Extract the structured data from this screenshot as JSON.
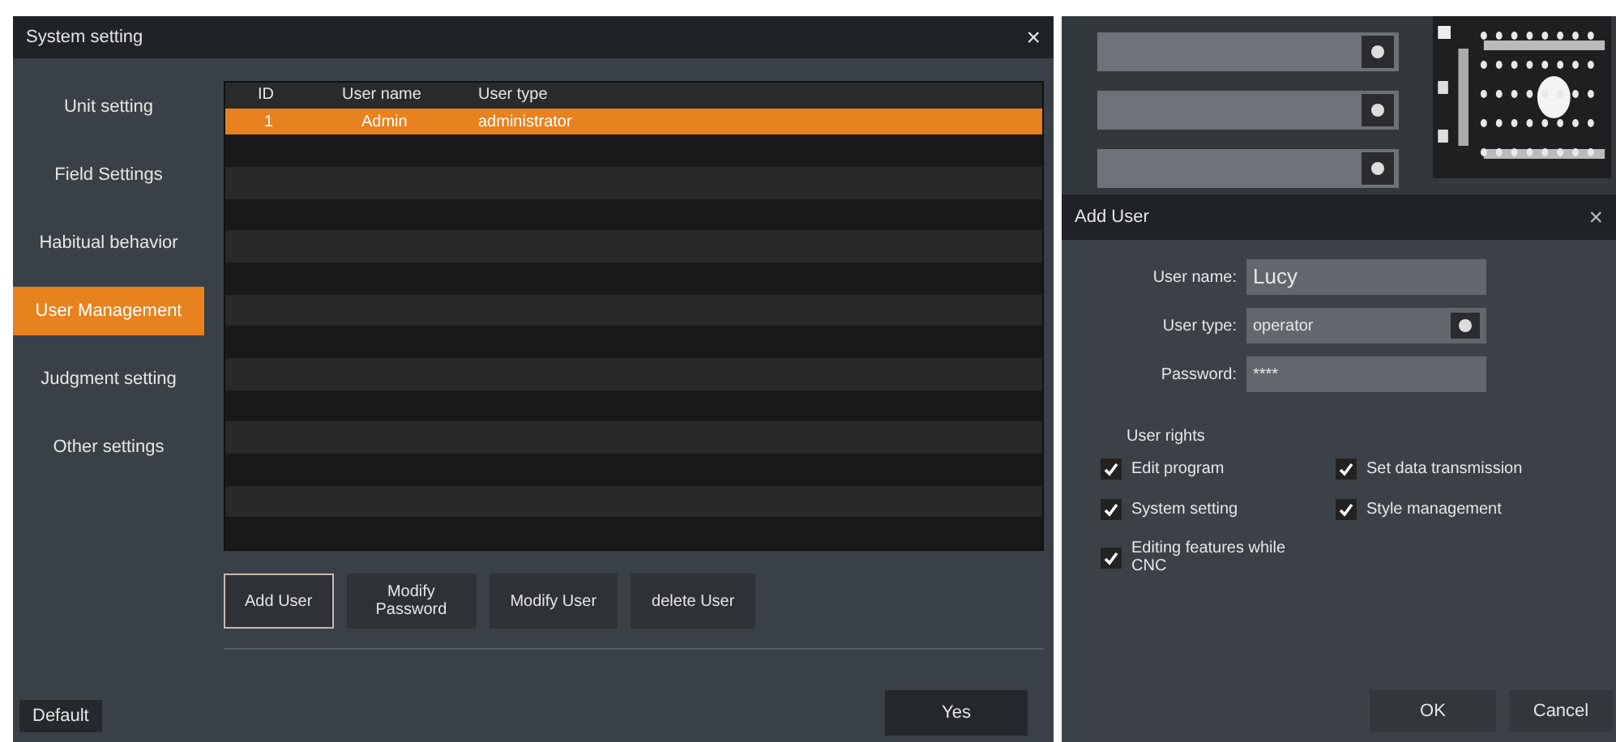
{
  "system_window": {
    "title": "System setting",
    "close": "×"
  },
  "sidebar": {
    "items": [
      {
        "label": "Unit setting",
        "selected": false
      },
      {
        "label": "Field Settings",
        "selected": false
      },
      {
        "label": "Habitual behavior",
        "selected": false
      },
      {
        "label": "User Management",
        "selected": true
      },
      {
        "label": "Judgment setting",
        "selected": false
      },
      {
        "label": "Other settings",
        "selected": false
      }
    ]
  },
  "table": {
    "columns": [
      "ID",
      "User name",
      "User type"
    ],
    "rows": [
      {
        "cells": [
          "1",
          "Admin",
          "administrator"
        ],
        "selected": true
      }
    ]
  },
  "buttons": [
    {
      "label": "Add User",
      "selected": true
    },
    {
      "label": "Modify Password",
      "selected": false
    },
    {
      "label": "Modify User",
      "selected": false
    },
    {
      "label": "delete User",
      "selected": false
    }
  ],
  "default_button": "Default",
  "yes_button": "Yes",
  "add_user_dialog": {
    "title": "Add User",
    "close": "×",
    "fields": [
      {
        "kind": "text",
        "label": "User name:",
        "value": "Lucy"
      },
      {
        "kind": "select",
        "label": "User type:",
        "value": "operator"
      },
      {
        "kind": "text",
        "label": "Password:",
        "value": "****"
      }
    ],
    "rights_title": "User rights",
    "rights": [
      {
        "label": "Edit program",
        "checked": true
      },
      {
        "label": "Set data transmission",
        "checked": true
      },
      {
        "label": "System setting",
        "checked": true
      },
      {
        "label": "Style management",
        "checked": true
      },
      {
        "label": "Editing features while CNC",
        "checked": true
      }
    ],
    "ok": "OK",
    "cancel": "Cancel"
  }
}
